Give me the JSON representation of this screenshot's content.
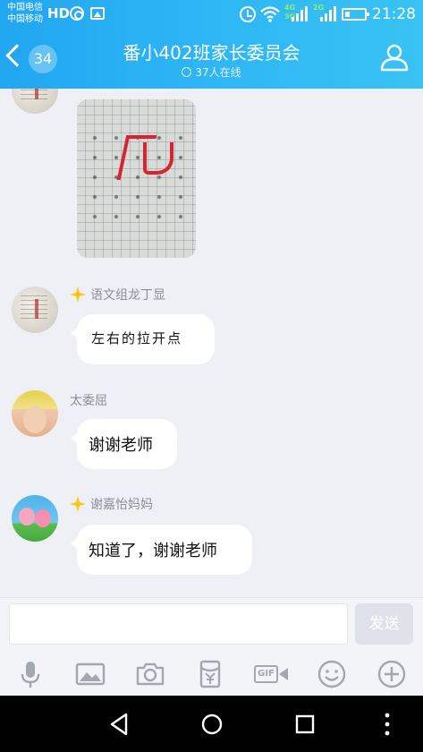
{
  "status_bar": {
    "carrier_1": "中国电信",
    "carrier_2": "中国移动",
    "hd_label": "HD",
    "sig1_tag_top": "4G",
    "sig1_tag_bottom": "3G",
    "sig2_tag": "2G",
    "time": "21:28",
    "icons": [
      "nfc-icon",
      "image-icon",
      "alarm-icon",
      "wifi-icon",
      "signal-icon",
      "battery-icon"
    ]
  },
  "header": {
    "unread_count": "34",
    "title": "番小402班家长委员会",
    "online_status": "37人在线",
    "accent_color": "#2fb6f5"
  },
  "messages": [
    {
      "type": "image",
      "sender": "",
      "avatar": "calligraphy-avatar"
    },
    {
      "type": "text",
      "sender": "语文组龙丁显",
      "role_badge": "star-badge-icon",
      "text": "左右的拉开点",
      "avatar": "calligraphy-avatar"
    },
    {
      "type": "text",
      "sender": "太委屈",
      "text": "谢谢老师",
      "avatar": "girl-avatar"
    },
    {
      "type": "text",
      "sender": "谢嘉怡妈妈",
      "role_badge": "star-badge-icon",
      "text": "知道了，谢谢老师",
      "avatar": "peppa-pig-avatar"
    }
  ],
  "composer": {
    "input_value": "",
    "send_label": "发送"
  },
  "toolbar": {
    "gif_label": "GIF",
    "items": [
      "microphone-icon",
      "image-icon",
      "camera-icon",
      "red-packet-icon",
      "gif-icon",
      "emoji-icon",
      "plus-icon"
    ]
  },
  "navbar": {
    "items": [
      "back-triangle-icon",
      "home-circle-icon",
      "recents-square-icon",
      "more-dots-icon"
    ]
  }
}
